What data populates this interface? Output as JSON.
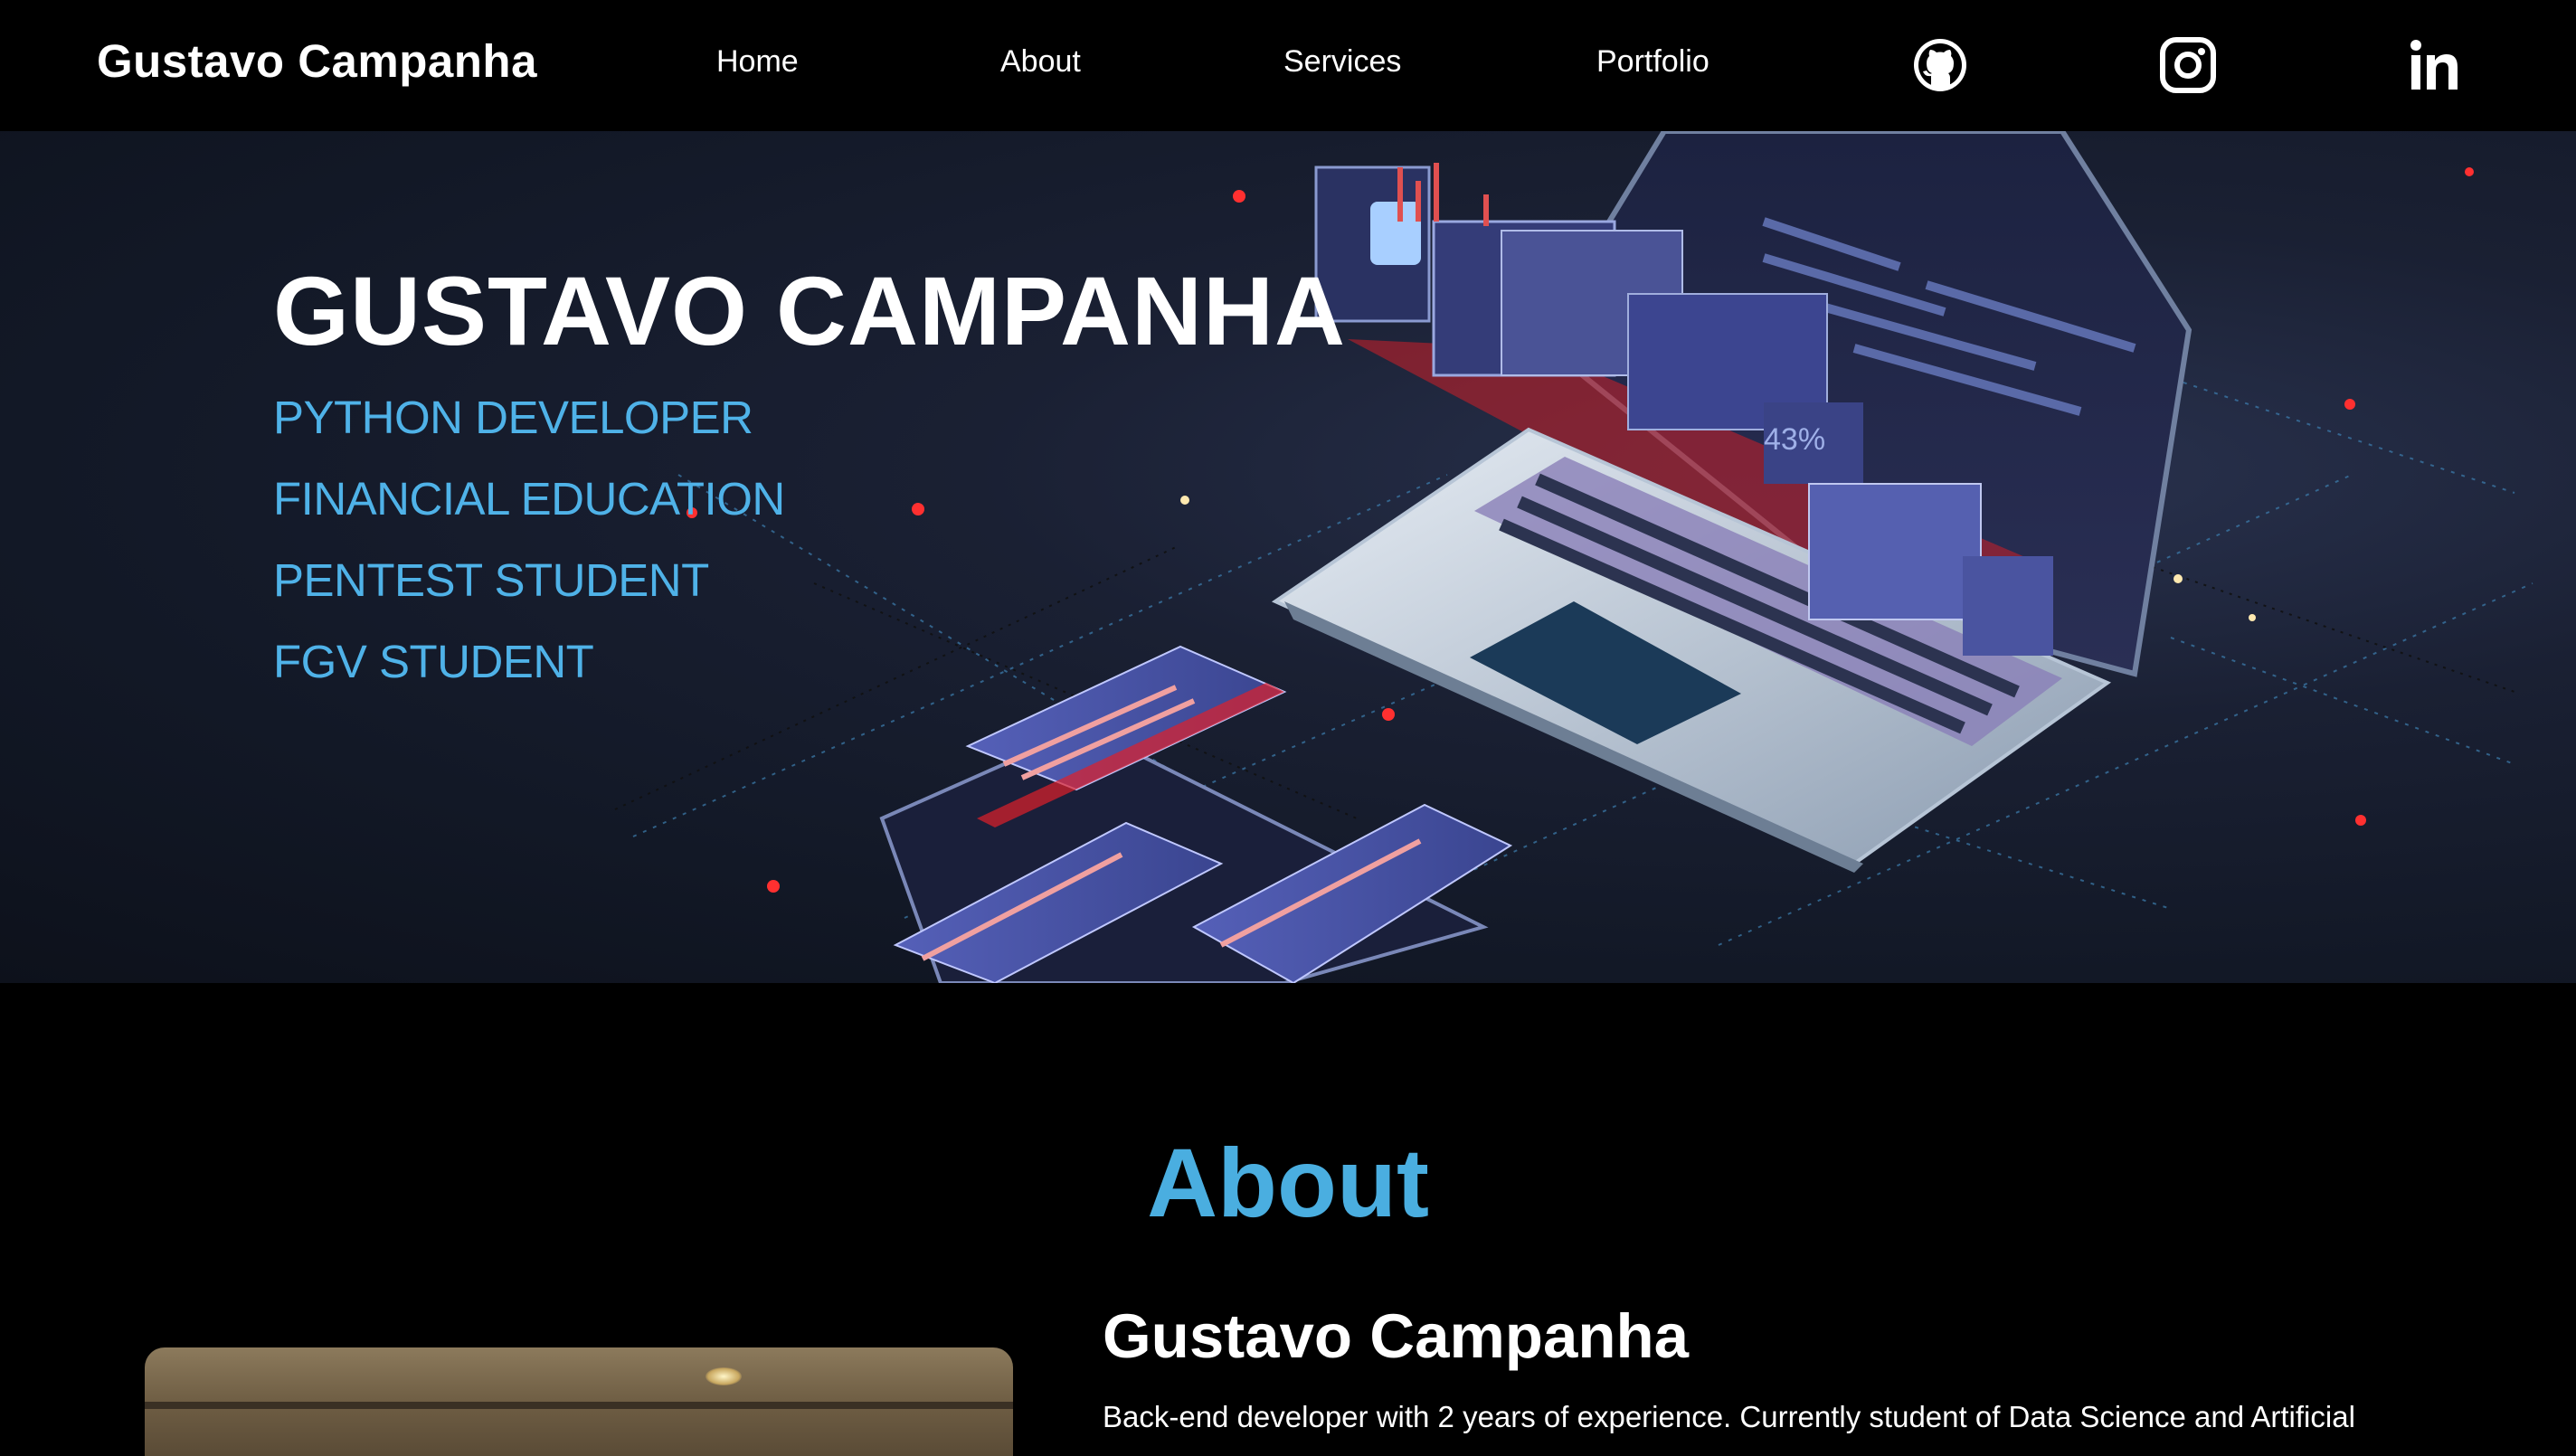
{
  "nav": {
    "brand": "Gustavo Campanha",
    "links": [
      "Home",
      "About",
      "Services",
      "Portfolio"
    ],
    "social": [
      "github-icon",
      "instagram-icon",
      "linkedin-icon"
    ]
  },
  "hero": {
    "title": "GUSTAVO CAMPANHA",
    "roles": [
      "PYTHON DEVELOPER",
      "FINANCIAL EDUCATION",
      "PENTEST STUDENT",
      "FGV STUDENT"
    ],
    "screen_percent": "43%"
  },
  "about": {
    "heading": "About",
    "name": "Gustavo Campanha",
    "text": "Back-end developer with 2 years of experience. Currently student of Data Science and Artificial"
  },
  "colors": {
    "accent": "#4fb2e8",
    "about_heading": "#4aaee0",
    "background": "#000000"
  }
}
